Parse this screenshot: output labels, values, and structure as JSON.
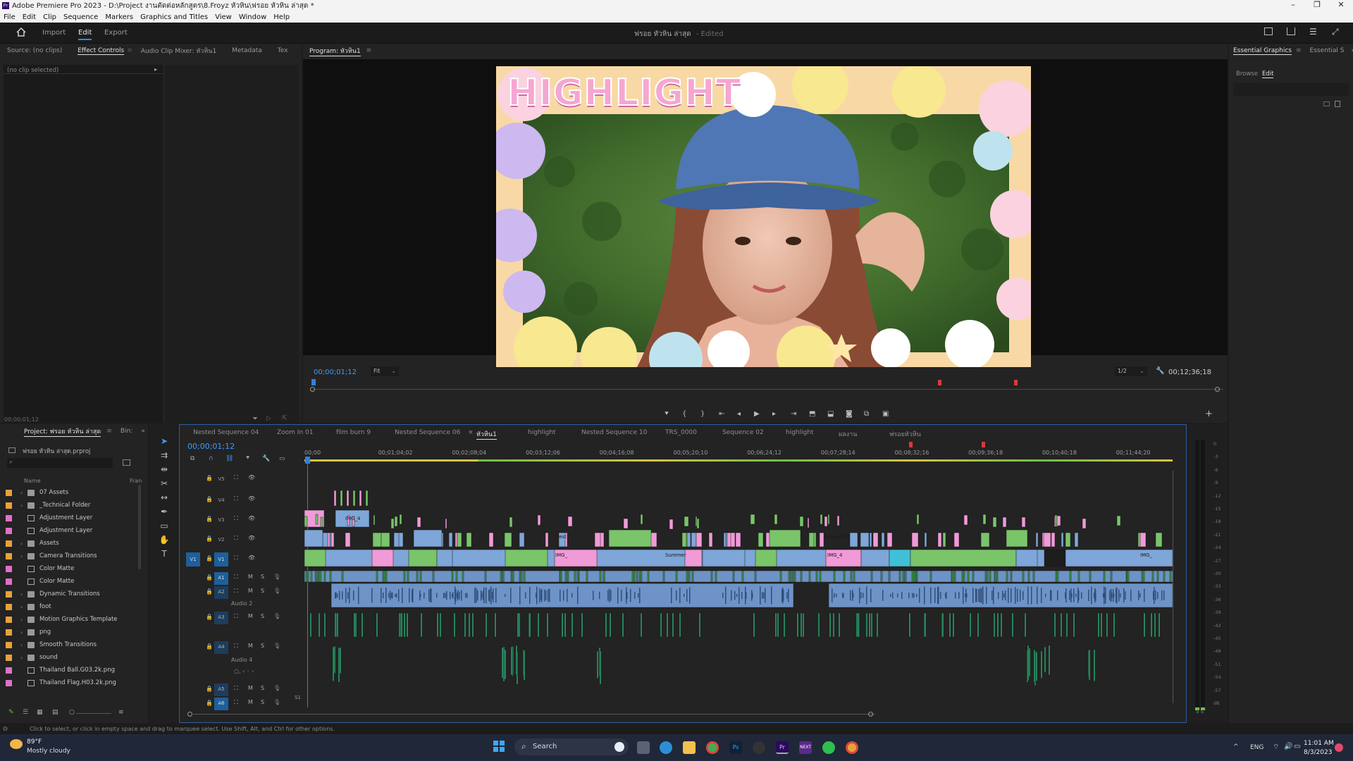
{
  "titlebar": {
    "title": "Adobe Premiere Pro 2023 - D:\\Project งานตัดต่อหลักสูตร\\8.Froyz หัวหิน\\ฟรอย หัวหิน ล่าสุด *"
  },
  "menu": [
    "File",
    "Edit",
    "Clip",
    "Sequence",
    "Markers",
    "Graphics and Titles",
    "View",
    "Window",
    "Help"
  ],
  "workspace": {
    "tabs": [
      "Import",
      "Edit",
      "Export"
    ],
    "active_tab": "Edit",
    "doc_title": "ฟรอย หัวหิน ล่าสุด",
    "doc_status": "- Edited"
  },
  "source_panel": {
    "tabs": [
      "Source: (no clips)",
      "Effect Controls",
      "Audio Clip Mixer: หัวหิน1",
      "Metadata",
      "Tex"
    ],
    "active_tab": "Effect Controls",
    "no_clip": "(no clip selected)",
    "timecode": "00;00;01;12"
  },
  "program_monitor": {
    "title": "Program: หัวหิน1",
    "overlay_text": "HIGHLIGHT",
    "timecode": "00;00;01;12",
    "fit": "Fit",
    "resolution": "1/2",
    "duration": "00;12;36;18"
  },
  "essential_graphics": {
    "tabs": [
      "Essential Graphics",
      "Essential S"
    ],
    "subtabs": [
      "Browse",
      "Edit"
    ]
  },
  "project_panel": {
    "tabs": [
      "Project: ฟรอย หัวหิน ล่าสุด",
      "Bin:"
    ],
    "project_file": "ฟรอย หัวหิน ล่าสุด.prproj",
    "col_name": "Name",
    "col_frame": "Fran",
    "items": [
      {
        "label": "07 Assets",
        "type": "folder",
        "color": "#e8a23a"
      },
      {
        "label": "_Technical Folder",
        "type": "folder",
        "color": "#e8a23a"
      },
      {
        "label": "Adjustment Layer",
        "type": "file",
        "color": "#e070c8"
      },
      {
        "label": "Adjustment Layer",
        "type": "file",
        "color": "#e070c8"
      },
      {
        "label": "Assets",
        "type": "folder",
        "color": "#e8a23a"
      },
      {
        "label": "Camera Transitions",
        "type": "folder",
        "color": "#e8a23a"
      },
      {
        "label": "Color Matte",
        "type": "file",
        "color": "#e070c8"
      },
      {
        "label": "Color Matte",
        "type": "file",
        "color": "#e070c8"
      },
      {
        "label": "Dynamic Transitions",
        "type": "folder",
        "color": "#e8a23a"
      },
      {
        "label": "foot",
        "type": "folder",
        "color": "#e8a23a"
      },
      {
        "label": "Motion Graphics Template",
        "type": "folder",
        "color": "#e8a23a"
      },
      {
        "label": "png",
        "type": "folder",
        "color": "#e8a23a"
      },
      {
        "label": "Smooth Transitions",
        "type": "folder",
        "color": "#e8a23a"
      },
      {
        "label": "sound",
        "type": "folder",
        "color": "#e8a23a"
      },
      {
        "label": "Thailand Ball.G03.2k.png",
        "type": "file",
        "color": "#e070c8"
      },
      {
        "label": "Thailand Flag.H03.2k.png",
        "type": "file",
        "color": "#e070c8"
      }
    ]
  },
  "timeline": {
    "tabs": [
      "Nested Sequence 04",
      "Zoom In 01",
      "film burn 9",
      "Nested Sequence 06",
      "หัวหิน1",
      "highlight",
      "Nested Sequence 10",
      "TRS_0000",
      "Sequence 02",
      "highlight",
      "ผลงาน",
      "ฟรอยหัวหิน"
    ],
    "active_tab": "หัวหิน1",
    "timecode": "00;00;01;12",
    "ruler": [
      "00;00",
      "00;01;04;02",
      "00;02;08;04",
      "00;03;12;06",
      "00;04;16;08",
      "00;05;20;10",
      "00;06;24;12",
      "00;07;28;14",
      "00;08;32;16",
      "00;09;36;18",
      "00;10;40;18",
      "00;11;44;20"
    ],
    "video_tracks": [
      "V5",
      "V4",
      "V3",
      "V2",
      "V1"
    ],
    "audio_tracks": [
      "A1",
      "A2",
      "A3",
      "A4",
      "A5",
      "A6"
    ],
    "audio_labels": {
      "a2": "Audio 2",
      "a4": "Audio 4"
    },
    "clip_names": [
      "IMG_4",
      "Nest",
      "Nested Se",
      "IMG_",
      "Summer",
      "IMG_4",
      "IMG_"
    ],
    "meter_scale": [
      "0",
      "-3",
      "-6",
      "-9",
      "-12",
      "-15",
      "-18",
      "-21",
      "-24",
      "-27",
      "-30",
      "-33",
      "-36",
      "-39",
      "-42",
      "-45",
      "-48",
      "-51",
      "-54",
      "-57",
      "dB"
    ],
    "meter_footer": "S S"
  },
  "status_bar": {
    "text": "Click to select, or click in empty space and drag to marquee select. Use Shift, Alt, and Ctrl for other options."
  },
  "taskbar": {
    "weather_temp": "89°F",
    "weather_desc": "Mostly cloudy",
    "search": "Search",
    "lang": "ENG",
    "time": "11:01 AM",
    "date": "8/3/2023"
  }
}
